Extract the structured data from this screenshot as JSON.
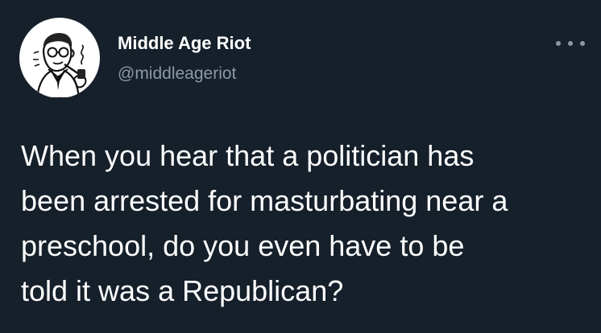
{
  "author": {
    "display_name": "Middle Age Riot",
    "handle": "@middleageriot",
    "avatar_icon": "vintage-man-smoking-pipe-illustration"
  },
  "more_icon": "more-options-icon",
  "tweet": {
    "text": "When you hear that a politician has\nbeen arrested for masturbating near a\npreschool, do you even have to be\ntold it was a Republican?"
  },
  "colors": {
    "background": "#15202b",
    "primary_text": "#ffffff",
    "secondary_text": "#8b98a5"
  }
}
